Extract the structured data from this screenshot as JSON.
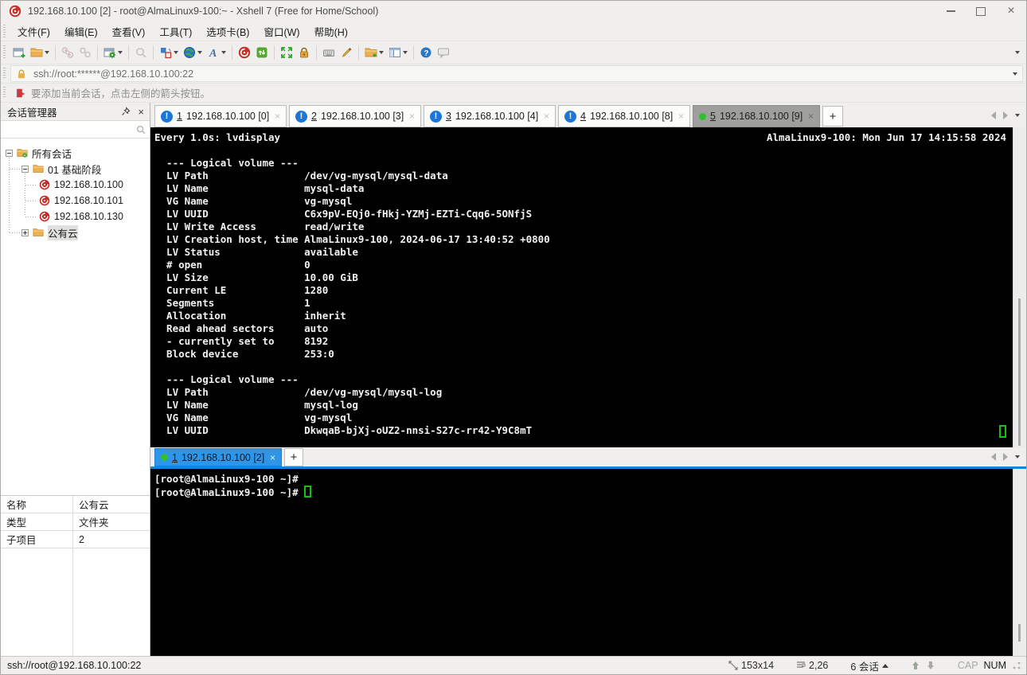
{
  "window": {
    "title": "192.168.10.100 [2] - root@AlmaLinux9-100:~ - Xshell 7 (Free for Home/School)"
  },
  "menu": {
    "items": [
      "文件(F)",
      "编辑(E)",
      "查看(V)",
      "工具(T)",
      "选项卡(B)",
      "窗口(W)",
      "帮助(H)"
    ]
  },
  "toolbar": {
    "icons": [
      "new-session",
      "open-folder",
      "disconnect",
      "reconnect",
      "session-properties",
      "find",
      "transfer",
      "web-browser",
      "font",
      "xshell",
      "xftp",
      "fullscreen",
      "lock",
      "virtual-keyboard",
      "compose-pen",
      "new-terminal",
      "tile-layout",
      "help",
      "feedback"
    ]
  },
  "address": {
    "url": "ssh://root:******@192.168.10.100:22"
  },
  "infobar": {
    "text": "要添加当前会话，点击左侧的箭头按钮。"
  },
  "session_manager": {
    "title": "会话管理器",
    "tree": [
      {
        "label": "所有会话"
      },
      {
        "label": "01 基础阶段"
      },
      {
        "label": "192.168.10.100"
      },
      {
        "label": "192.168.10.101"
      },
      {
        "label": "192.168.10.130"
      },
      {
        "label": "公有云"
      }
    ],
    "properties": {
      "rows": [
        {
          "key": "名称",
          "value": "公有云"
        },
        {
          "key": "类型",
          "value": "文件夹"
        },
        {
          "key": "子项目",
          "value": "2"
        }
      ]
    }
  },
  "tabs": {
    "top": [
      {
        "num": "1",
        "label": "192.168.10.100 [0]"
      },
      {
        "num": "2",
        "label": "192.168.10.100 [3]"
      },
      {
        "num": "3",
        "label": "192.168.10.100 [4]"
      },
      {
        "num": "4",
        "label": "192.168.10.100 [8]"
      },
      {
        "num": "5",
        "label": "192.168.10.100 [9]"
      }
    ],
    "bottom": [
      {
        "num": "1",
        "label": "192.168.10.100 [2]"
      }
    ]
  },
  "terminal_top": {
    "header_left": "Every 1.0s: lvdisplay",
    "header_right": "AlmaLinux9-100: Mon Jun 17 14:15:58 2024",
    "body": "\n  --- Logical volume ---\n  LV Path                /dev/vg-mysql/mysql-data\n  LV Name                mysql-data\n  VG Name                vg-mysql\n  LV UUID                C6x9pV-EQj0-fHkj-YZMj-EZTi-Cqq6-5ONfjS\n  LV Write Access        read/write\n  LV Creation host, time AlmaLinux9-100, 2024-06-17 13:40:52 +0800\n  LV Status              available\n  # open                 0\n  LV Size                10.00 GiB\n  Current LE             1280\n  Segments               1\n  Allocation             inherit\n  Read ahead sectors     auto\n  - currently set to     8192\n  Block device           253:0\n\n  --- Logical volume ---\n  LV Path                /dev/vg-mysql/mysql-log\n  LV Name                mysql-log\n  VG Name                vg-mysql\n  LV UUID                DkwqaB-bjXj-oUZ2-nnsi-S27c-rr42-Y9C8mT"
  },
  "terminal_bottom": {
    "prompt1": "[root@AlmaLinux9-100 ~]#",
    "prompt2": "[root@AlmaLinux9-100 ~]# "
  },
  "status": {
    "url": "ssh://root@192.168.10.100:22",
    "size": "153x14",
    "position": "2,26",
    "sessions": "6 会话",
    "cap": "CAP",
    "num": "NUM"
  },
  "colors": {
    "terminal_bg": "#000000",
    "terminal_fg": "#f2f2f2",
    "cursor_green": "#12c312",
    "focus_blue": "#1286dc",
    "active_tab_gray": "#9f9f9d",
    "alert_blue": "#1b76d6",
    "xshell_red": "#c62f28",
    "folder_yellow": "#edb04e",
    "lock_orange": "#e0a33c"
  }
}
